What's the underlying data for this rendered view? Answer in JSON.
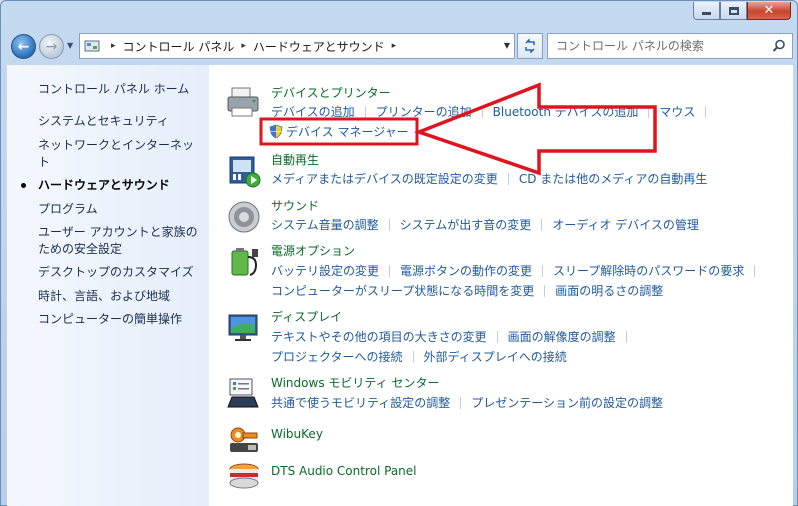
{
  "caption": {
    "min_icon": "minimize-icon",
    "max_icon": "maximize-icon",
    "close_glyph": "✕"
  },
  "nav": {
    "back_glyph": "←",
    "forward_glyph": "→",
    "history_glyph": "▼"
  },
  "address": {
    "crumbs": [
      "コントロール パネル",
      "ハードウェアとサウンド"
    ],
    "separator": "▸"
  },
  "search": {
    "placeholder": "コントロール パネルの検索"
  },
  "sidebar": {
    "home": "コントロール パネル ホーム",
    "items": [
      "システムとセキュリティ",
      "ネットワークとインターネット",
      "ハードウェアとサウンド",
      "プログラム",
      "ユーザー アカウントと家族のための安全設定",
      "デスクトップのカスタマイズ",
      "時計、言語、および地域",
      "コンピューターの簡単操作"
    ],
    "item_lines": {
      "network_1": "ネットワークとインターネッ",
      "network_2": "ト",
      "user_1": "ユーザー アカウントと家族の",
      "user_2": "ための安全設定"
    }
  },
  "categories": {
    "devices": {
      "title": "デバイスとプリンター",
      "tasks": [
        "デバイスの追加",
        "プリンターの追加",
        "Bluetooth デバイスの追加",
        "マウス"
      ],
      "device_manager": "デバイス マネージャー"
    },
    "autoplay": {
      "title": "自動再生",
      "tasks": [
        "メディアまたはデバイスの既定設定の変更",
        "CD または他のメディアの自動再生"
      ]
    },
    "sound": {
      "title": "サウンド",
      "tasks": [
        "システム音量の調整",
        "システムが出す音の変更",
        "オーディオ デバイスの管理"
      ]
    },
    "power": {
      "title": "電源オプション",
      "tasks_row1": [
        "バッテリ設定の変更",
        "電源ボタンの動作の変更",
        "スリープ解除時のパスワードの要求"
      ],
      "tasks_row2": [
        "コンピューターがスリープ状態になる時間を変更",
        "画面の明るさの調整"
      ]
    },
    "display": {
      "title": "ディスプレイ",
      "tasks_row1": [
        "テキストやその他の項目の大きさの変更",
        "画面の解像度の調整"
      ],
      "tasks_row2": [
        "プロジェクターへの接続",
        "外部ディスプレイへの接続"
      ]
    },
    "mobility": {
      "title": "Windows モビリティ センター",
      "tasks": [
        "共通で使うモビリティ設定の調整",
        "プレゼンテーション前の設定の調整"
      ]
    },
    "wibukey": {
      "title": "WibuKey"
    },
    "dts": {
      "title": "DTS Audio Control Panel"
    }
  },
  "colors": {
    "highlight_red": "#e0141e",
    "link_blue": "#1f5a9c",
    "category_green": "#0a6a29"
  }
}
